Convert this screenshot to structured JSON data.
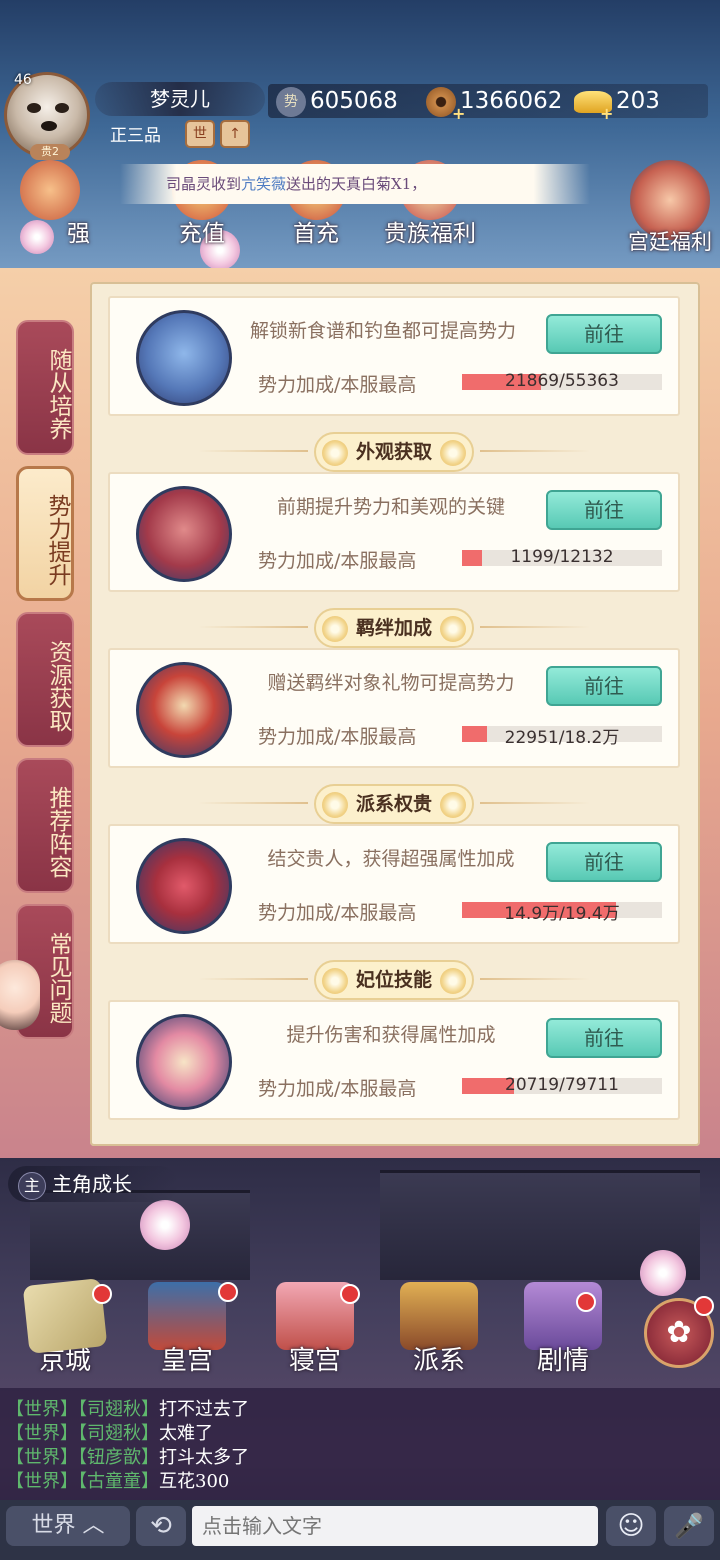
{
  "player": {
    "level": "46",
    "name": "梦灵儿",
    "rank": "正三品",
    "vip": "贵2",
    "rank_btn_1": "世",
    "rank_btn_2": "↑"
  },
  "currencies": {
    "influence": "605068",
    "coins": "1366062",
    "ingots": "203",
    "influence_icon": "势"
  },
  "marquee": {
    "prefix": "司晶灵收到",
    "sender": "亢笑薇",
    "suffix": "送出的天真白菊X1，"
  },
  "features": [
    {
      "label": "强",
      "icon": "strength-icon"
    },
    {
      "label": "充值",
      "icon": "recharge-icon"
    },
    {
      "label": "首充",
      "icon": "first-recharge-icon"
    },
    {
      "label": "贵族福利",
      "icon": "noble-welfare-icon"
    },
    {
      "label": "宫廷福利",
      "icon": "palace-welfare-icon"
    }
  ],
  "tabs": [
    {
      "label": "随从培养",
      "active": false
    },
    {
      "label": "势力提升",
      "active": true
    },
    {
      "label": "资源获取",
      "active": false
    },
    {
      "label": "推荐阵容",
      "active": false
    },
    {
      "label": "常见问题",
      "active": false
    }
  ],
  "cards": [
    {
      "section": "",
      "desc": "解锁新食谱和钓鱼都可提高势力",
      "button": "前往",
      "stat_label": "势力加成/本服最高",
      "value": "21869/55363",
      "progress": 0.395,
      "icon": "recipe-book-icon"
    },
    {
      "section": "外观获取",
      "desc": "前期提升势力和美观的关键",
      "button": "前往",
      "stat_label": "势力加成/本服最高",
      "value": "1199/12132",
      "progress": 0.099,
      "icon": "parasol-icon"
    },
    {
      "section": "羁绊加成",
      "desc": "赠送羁绊对象礼物可提高势力",
      "button": "前往",
      "stat_label": "势力加成/本服最高",
      "value": "22951/18.2万",
      "progress": 0.126,
      "icon": "merchant-lantern-icon"
    },
    {
      "section": "派系权贵",
      "desc": "结交贵人，获得超强属性加成",
      "button": "前往",
      "stat_label": "势力加成/本服最高",
      "value": "14.9万/19.4万",
      "progress": 0.768,
      "icon": "faction-pavilion-icon"
    },
    {
      "section": "妃位技能",
      "desc": "提升伤害和获得属性加成",
      "button": "前往",
      "stat_label": "势力加成/本服最高",
      "value": "20719/79711",
      "progress": 0.26,
      "icon": "fan-icon"
    }
  ],
  "chapter": {
    "badge": "主",
    "label": "主角成长"
  },
  "nav": [
    {
      "label": "京城",
      "icon": "map-icon"
    },
    {
      "label": "皇宫",
      "icon": "palace-icon"
    },
    {
      "label": "寝宫",
      "icon": "bedroom-icon"
    },
    {
      "label": "派系",
      "icon": "faction-icon"
    },
    {
      "label": "剧情",
      "icon": "story-book-icon"
    }
  ],
  "chat": [
    {
      "channel": "【世界】",
      "user": "【司翅秋】",
      "msg": "打不过去了"
    },
    {
      "channel": "【世界】",
      "user": "【司翅秋】",
      "msg": "太难了"
    },
    {
      "channel": "【世界】",
      "user": "【钮彦歆】",
      "msg": "打斗太多了"
    },
    {
      "channel": "【世界】",
      "user": "【古童童】",
      "msg": "互花300"
    }
  ],
  "input": {
    "channel": "世界",
    "placeholder": "点击输入文字"
  },
  "colors": {
    "accent_teal": "#58c9b4",
    "progress_red": "#f06c6c",
    "tab_active": "#f2d3a3",
    "tab_inactive": "#8a3446"
  }
}
